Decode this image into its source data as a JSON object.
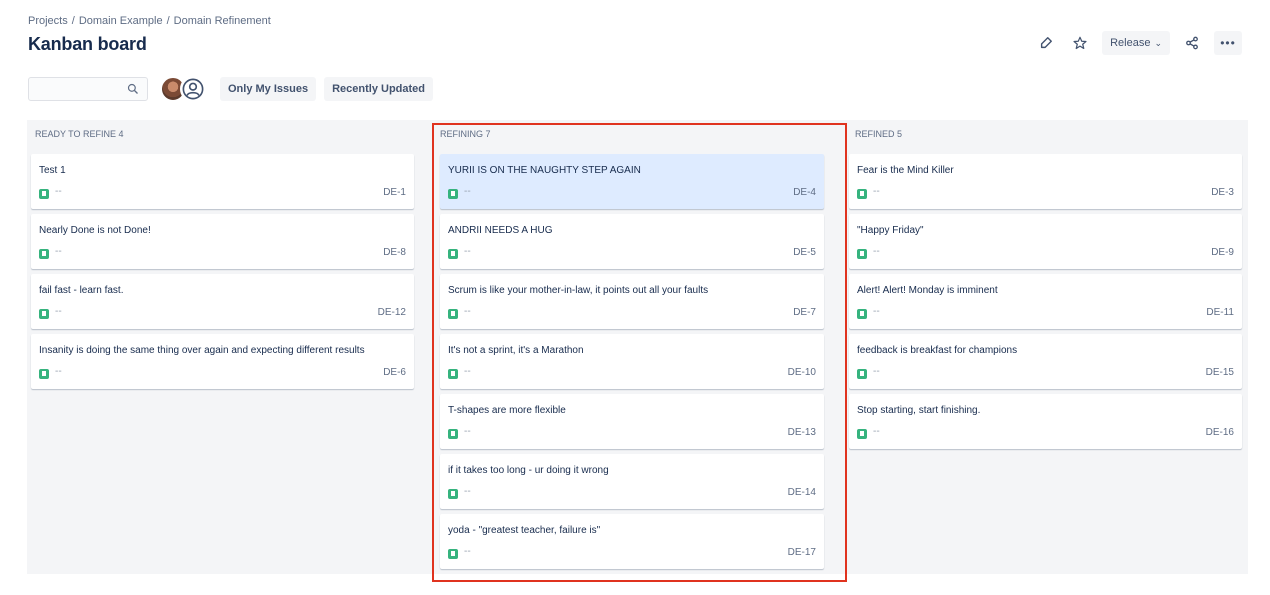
{
  "breadcrumb": [
    "Projects",
    "Domain Example",
    "Domain Refinement"
  ],
  "breadcrumb_separator": "/",
  "title": "Kanban board",
  "actions": {
    "release_label": "Release",
    "release_chevron": "⌄",
    "more_label": "•••"
  },
  "filters": {
    "search_placeholder": "",
    "only_my_issues": "Only My Issues",
    "recently_updated": "Recently Updated"
  },
  "colors": {
    "accent_highlight": "#e0331f",
    "story_icon": "#36b37e",
    "selected_card": "#deebff",
    "board_bg": "#f4f5f7"
  },
  "columns": [
    {
      "header": "READY TO REFINE 4",
      "cards": [
        {
          "summary": "Test 1",
          "dash": "--",
          "key": "DE-1"
        },
        {
          "summary": "Nearly Done is not Done!",
          "dash": "--",
          "key": "DE-8"
        },
        {
          "summary": "fail fast - learn fast.",
          "dash": "--",
          "key": "DE-12"
        },
        {
          "summary": "Insanity is doing the same thing over again and expecting different results",
          "dash": "--",
          "key": "DE-6"
        }
      ]
    },
    {
      "header": "REFINING 7",
      "cards": [
        {
          "summary": "YURII IS ON THE NAUGHTY STEP AGAIN",
          "dash": "--",
          "key": "DE-4",
          "selected": true
        },
        {
          "summary": "ANDRII NEEDS A HUG",
          "dash": "--",
          "key": "DE-5"
        },
        {
          "summary": "Scrum is like your mother-in-law, it points out all your faults",
          "dash": "--",
          "key": "DE-7"
        },
        {
          "summary": "It's not a sprint, it's a Marathon",
          "dash": "--",
          "key": "DE-10"
        },
        {
          "summary": "T-shapes are more flexible",
          "dash": "--",
          "key": "DE-13"
        },
        {
          "summary": "if it takes too long - ur doing it wrong",
          "dash": "--",
          "key": "DE-14"
        },
        {
          "summary": "yoda - \"greatest teacher, failure is\"",
          "dash": "--",
          "key": "DE-17"
        }
      ]
    },
    {
      "header": "REFINED 5",
      "cards": [
        {
          "summary": "Fear is the Mind Killer",
          "dash": "--",
          "key": "DE-3"
        },
        {
          "summary": "\"Happy Friday\"",
          "dash": "--",
          "key": "DE-9"
        },
        {
          "summary": "Alert! Alert! Monday is imminent",
          "dash": "--",
          "key": "DE-11"
        },
        {
          "summary": "feedback is breakfast for champions",
          "dash": "--",
          "key": "DE-15"
        },
        {
          "summary": "Stop starting, start finishing.",
          "dash": "--",
          "key": "DE-16"
        }
      ]
    }
  ]
}
